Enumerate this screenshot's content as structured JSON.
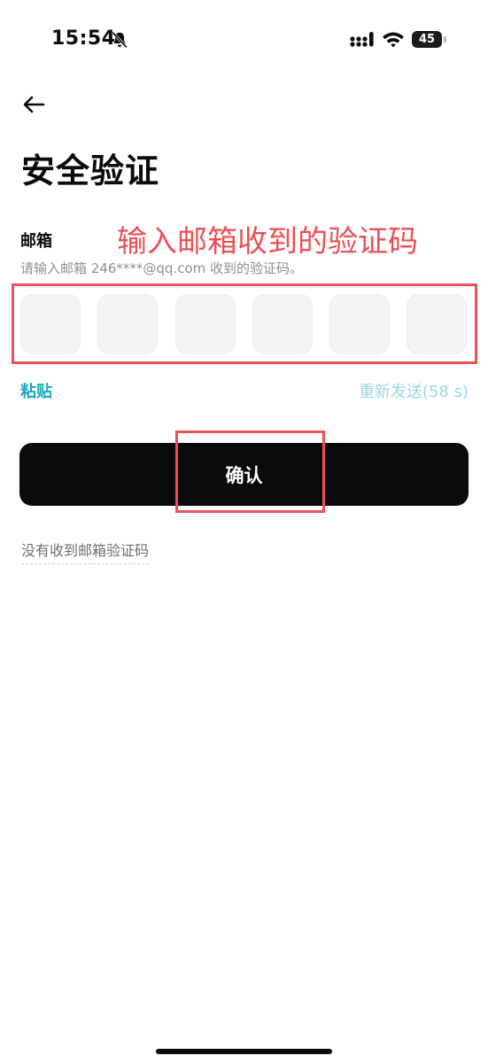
{
  "status_bar": {
    "time": "15:54",
    "battery": "45",
    "icons": [
      "bell-slash-icon",
      "signal-icon",
      "wifi-icon",
      "battery-icon"
    ]
  },
  "header": {
    "back_icon": "arrow-left-icon",
    "title": "安全验证"
  },
  "form": {
    "label": "邮箱",
    "hint": "请输入邮箱 246****@qq.com 收到的验证码。",
    "code_inputs": [
      "",
      "",
      "",
      "",
      "",
      ""
    ],
    "paste_label": "粘贴",
    "resend_label": "重新发送(58 s)",
    "confirm_label": "确认",
    "no_code_label": "没有收到邮箱验证码"
  },
  "annotation": {
    "text": "输入邮箱收到的验证码",
    "color": "#ef4f57"
  },
  "colors": {
    "accent": "#1aa7c0",
    "accent_disabled": "#9bd7e2",
    "button_bg": "#0b0b0b"
  }
}
